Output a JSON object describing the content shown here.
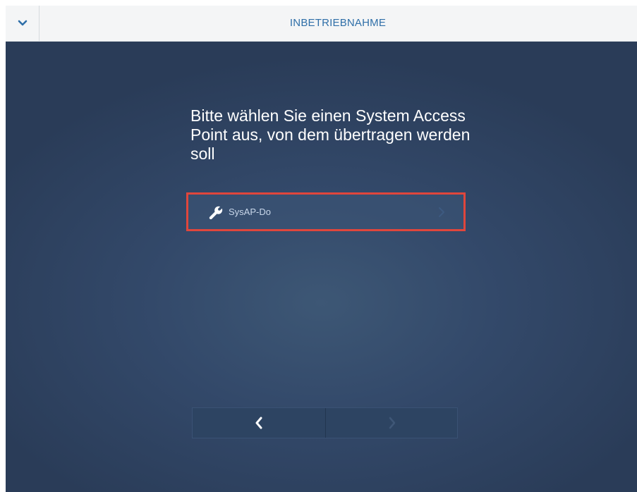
{
  "header": {
    "title": "INBETRIEBNAHME",
    "collapse_icon": "chevron-down-icon"
  },
  "main": {
    "prompt": "Bitte wählen Sie einen System Access Point aus, von dem übertragen werden soll",
    "devices": [
      {
        "label": "SysAP-Do",
        "icon": "wrench-icon",
        "selected": true
      }
    ]
  },
  "navigation": {
    "prev_icon": "chevron-left-icon",
    "next_icon": "chevron-right-icon",
    "next_enabled": false
  },
  "colors": {
    "title_blue": "#2f6fa8",
    "background": "#33496a",
    "highlight": "#e0463c"
  }
}
